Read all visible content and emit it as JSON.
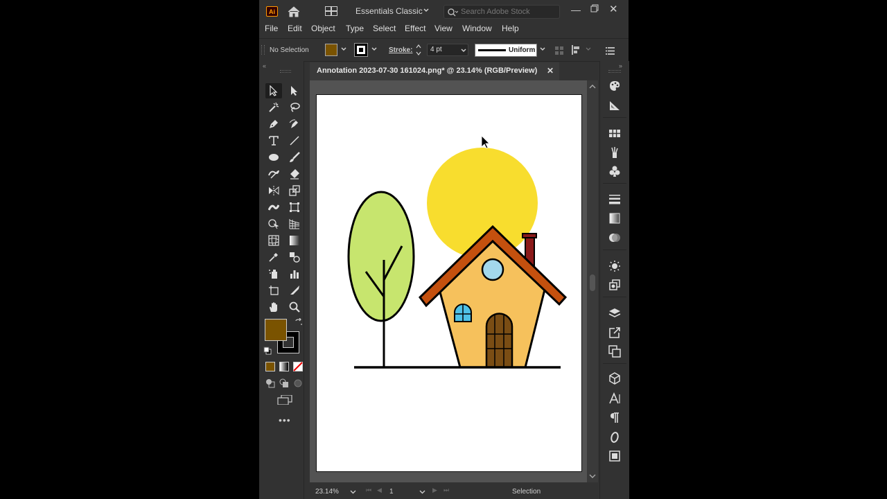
{
  "app": {
    "logo_text": "Ai",
    "workspace": "Essentials Classic",
    "search_placeholder": "Search Adobe Stock"
  },
  "menu": [
    "File",
    "Edit",
    "Object",
    "Type",
    "Select",
    "Effect",
    "View",
    "Window",
    "Help"
  ],
  "control": {
    "selection_status": "No Selection",
    "fill_color": "#7a5300",
    "stroke_label": "Stroke:",
    "stroke_weight": "4 pt",
    "profile": "Uniform"
  },
  "document": {
    "tab_title": "Annotation 2023-07-30 161024.png* @ 23.14% (RGB/Preview)"
  },
  "statusbar": {
    "zoom": "23.14%",
    "artboard": "1",
    "tool": "Selection"
  },
  "colors": {
    "fill": "#7a5300",
    "sun": "#f8dd2e",
    "tree": "#c7e56e",
    "house": "#f6c15c",
    "roof": "#c4500e",
    "chimney": "#8b1a1a",
    "window": "#a3d8ec",
    "door": "#7a4d14"
  }
}
